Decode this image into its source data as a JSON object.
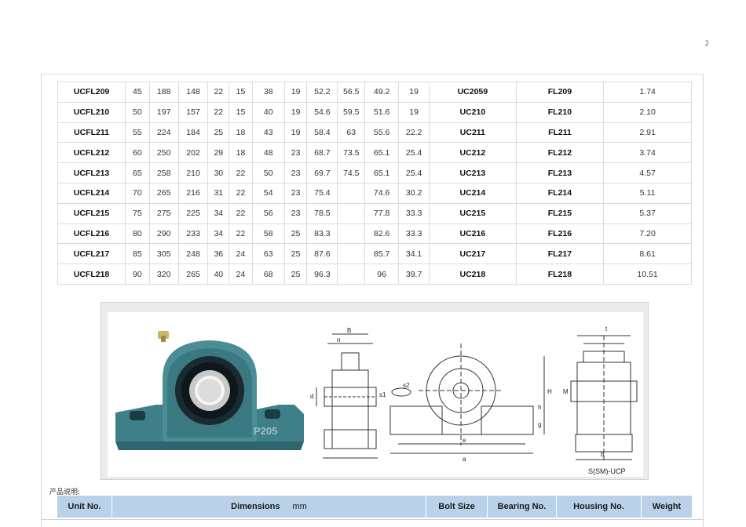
{
  "page_number": "2",
  "table": {
    "rows": [
      [
        "UCFL209",
        "45",
        "188",
        "148",
        "22",
        "15",
        "38",
        "19",
        "52.2",
        "56.5",
        "49.2",
        "19",
        "UC2059",
        "FL209",
        "1.74"
      ],
      [
        "UCFL210",
        "50",
        "197",
        "157",
        "22",
        "15",
        "40",
        "19",
        "54.6",
        "59.5",
        "51.6",
        "19",
        "UC210",
        "FL210",
        "2.10"
      ],
      [
        "UCFL211",
        "55",
        "224",
        "184",
        "25",
        "18",
        "43",
        "19",
        "58.4",
        "63",
        "55.6",
        "22.2",
        "UC211",
        "FL211",
        "2.91"
      ],
      [
        "UCFL212",
        "60",
        "250",
        "202",
        "29",
        "18",
        "48",
        "23",
        "68.7",
        "73.5",
        "65.1",
        "25.4",
        "UC212",
        "FL212",
        "3.74"
      ],
      [
        "UCFL213",
        "65",
        "258",
        "210",
        "30",
        "22",
        "50",
        "23",
        "69.7",
        "74.5",
        "65.1",
        "25.4",
        "UC213",
        "FL213",
        "4.57"
      ],
      [
        "UCFL214",
        "70",
        "265",
        "216",
        "31",
        "22",
        "54",
        "23",
        "75.4",
        "",
        "74.6",
        "30.2",
        "UC214",
        "FL214",
        "5.11"
      ],
      [
        "UCFL215",
        "75",
        "275",
        "225",
        "34",
        "22",
        "56",
        "23",
        "78.5",
        "",
        "77.8",
        "33.3",
        "UC215",
        "FL215",
        "5.37"
      ],
      [
        "UCFL216",
        "80",
        "290",
        "233",
        "34",
        "22",
        "58",
        "25",
        "83.3",
        "",
        "82.6",
        "33.3",
        "UC216",
        "FL216",
        "7.20"
      ],
      [
        "UCFL217",
        "85",
        "305",
        "248",
        "36",
        "24",
        "63",
        "25",
        "87.6",
        "",
        "85.7",
        "34.1",
        "UC217",
        "FL217",
        "8.61"
      ],
      [
        "UCFL218",
        "90",
        "320",
        "265",
        "40",
        "24",
        "68",
        "25",
        "96.3",
        "",
        "96",
        "39.7",
        "UC218",
        "FL218",
        "10.51"
      ]
    ]
  },
  "figure": {
    "product_marking": "P205",
    "drawing_caption": "S(SM)-UCP",
    "dimension_labels": {
      "B": "B",
      "n": "n",
      "d": "d",
      "s1": "s1",
      "s2": "s2",
      "H": "H",
      "h": "h",
      "g": "g",
      "e": "e",
      "a": "a",
      "M": "M",
      "t": "t",
      "b": "b"
    }
  },
  "section_caption": "产品说明:",
  "header": {
    "unit_no": "Unit No.",
    "dimensions": "Dimensions",
    "dimensions_unit": "mm",
    "bolt_size": "Bolt Size",
    "bearing_no": "Bearing No.",
    "housing_no": "Housing No.",
    "weight": "Weight"
  },
  "colors": {
    "header_bg": "#b9d2ea",
    "housing_teal": "#3e7f8a",
    "grid_line": "#dcdcdc"
  }
}
